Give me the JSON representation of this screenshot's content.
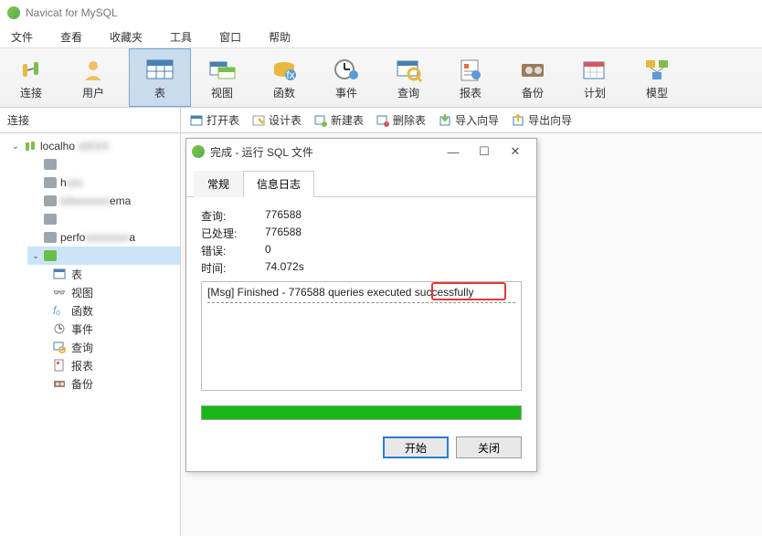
{
  "app": {
    "title": "Navicat for MySQL"
  },
  "menu": {
    "file": "文件",
    "view": "查看",
    "fav": "收藏夹",
    "tool": "工具",
    "window": "窗口",
    "help": "帮助"
  },
  "toolbar": {
    "connect": "连接",
    "user": "用户",
    "table": "表",
    "view": "视图",
    "func": "函数",
    "event": "事件",
    "query": "查询",
    "report": "报表",
    "backup": "备份",
    "plan": "计划",
    "model": "模型"
  },
  "subbar": {
    "left": "连接",
    "open": "打开表",
    "design": "设计表",
    "new": "新建表",
    "delete": "删除表",
    "import": "导入向导",
    "export": "导出向导"
  },
  "tree": {
    "root": "localho",
    "children": {
      "c1": "",
      "c2": "h",
      "c3": "ema",
      "c4": "",
      "c5": "perfo",
      "c5b": "a",
      "c6": ""
    },
    "leaves": {
      "table": "表",
      "view": "视图",
      "func": "函数",
      "event": "事件",
      "query": "查询",
      "report": "报表",
      "backup": "备份"
    }
  },
  "dialog": {
    "title": "完成 - 运行 SQL 文件",
    "tabs": {
      "general": "常规",
      "log": "信息日志"
    },
    "stats": {
      "k1": "查询:",
      "v1": "776588",
      "k2": "已处理:",
      "v2": "776588",
      "k3": "错误:",
      "v3": "0",
      "k4": "时间:",
      "v4": "74.072s"
    },
    "log_msg": "[Msg] Finished - 776588 queries executed successfully",
    "buttons": {
      "start": "开始",
      "close": "关闭"
    }
  }
}
